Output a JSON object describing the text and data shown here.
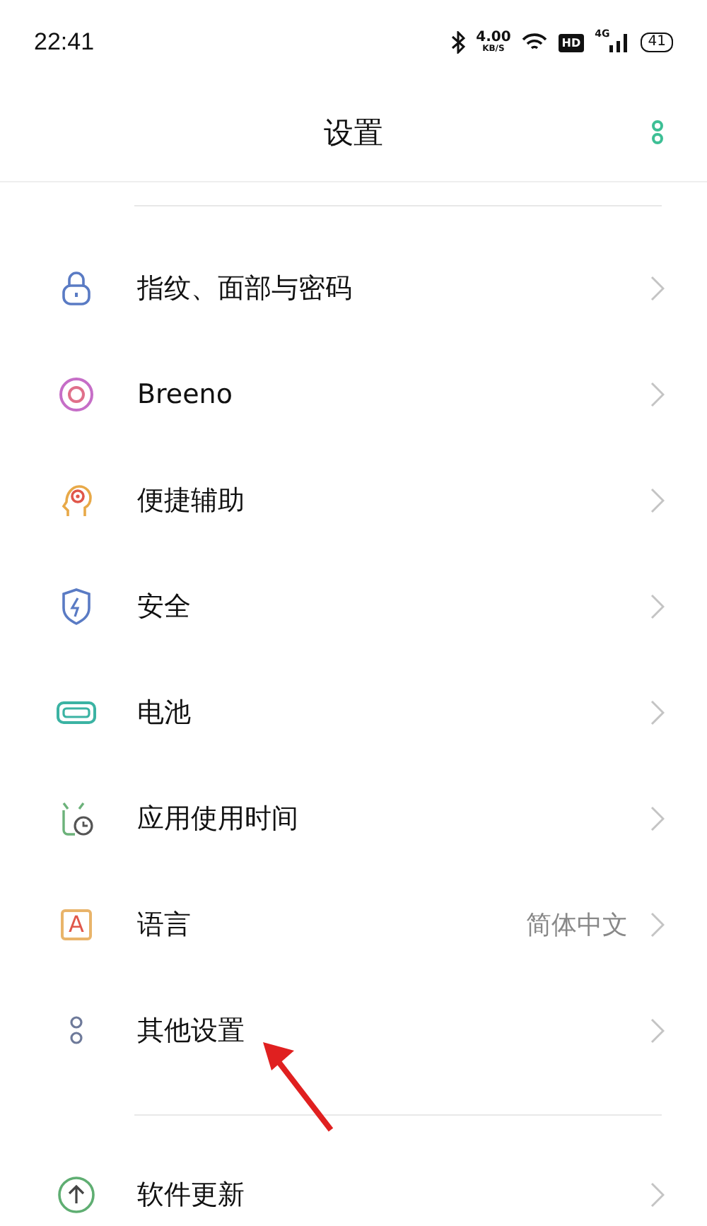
{
  "status_bar": {
    "time": "22:41",
    "speed_value": "4.00",
    "speed_unit": "KB/S",
    "hd": "HD",
    "network": "4G",
    "battery": "41"
  },
  "header": {
    "title": "设置"
  },
  "groups": [
    {
      "items": [
        {
          "kind": "lock",
          "label": "指纹、面部与密码"
        },
        {
          "kind": "ring",
          "label": "Breeno"
        },
        {
          "kind": "head",
          "label": "便捷辅助"
        },
        {
          "kind": "shield",
          "label": "安全"
        },
        {
          "kind": "battery",
          "label": "电池"
        },
        {
          "kind": "clock",
          "label": "应用使用时间"
        },
        {
          "kind": "letter",
          "label": "语言",
          "value": "简体中文",
          "icon_text": "A"
        },
        {
          "kind": "dots",
          "label": "其他设置"
        }
      ]
    },
    {
      "items": [
        {
          "kind": "update",
          "label": "软件更新"
        }
      ]
    }
  ]
}
